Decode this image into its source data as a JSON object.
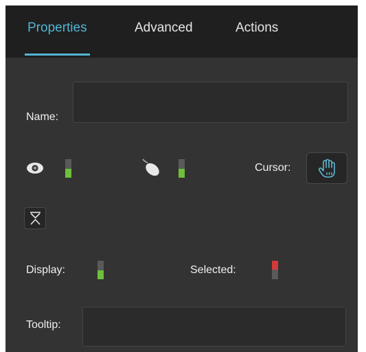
{
  "tabs": [
    {
      "label": "Properties",
      "active": true
    },
    {
      "label": "Advanced",
      "active": false
    },
    {
      "label": "Actions",
      "active": false
    }
  ],
  "name_field": {
    "label": "Name:",
    "value": ""
  },
  "visibility": {
    "icon": "eye-icon",
    "toggle_on": true
  },
  "mouse_enabled": {
    "icon": "mouse-icon",
    "toggle_on": true
  },
  "cursor": {
    "label": "Cursor:",
    "icon": "hand-cursor-icon"
  },
  "collapse": {
    "icon": "collapse-icon"
  },
  "display": {
    "label": "Display:",
    "toggle_on": true
  },
  "selected": {
    "label": "Selected:",
    "toggle_on": false
  },
  "tooltip_field": {
    "label": "Tooltip:",
    "value": ""
  },
  "colors": {
    "accent": "#52b6d3",
    "panel_bg": "#333333",
    "tabbar_bg": "#1f1f1f",
    "toggle_on": "#6fbf3a",
    "toggle_off": "#d33a3a"
  }
}
